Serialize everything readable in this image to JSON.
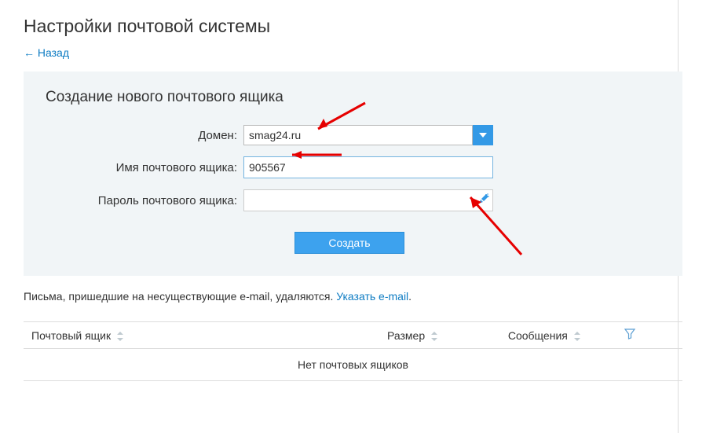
{
  "page_title": "Настройки почтовой системы",
  "back_link": "← Назад",
  "panel": {
    "title": "Создание нового почтового ящика",
    "domain_label": "Домен:",
    "domain_value": "smag24.ru",
    "mailbox_label": "Имя почтового ящика:",
    "mailbox_value": "905567",
    "password_label": "Пароль почтового ящика:",
    "password_value": "",
    "create_button": "Создать"
  },
  "info": {
    "text": "Письма, пришедшие на несуществующие e-mail, удаляются. ",
    "link": "Указать e-mail",
    "dot": "."
  },
  "table": {
    "col_mailbox": "Почтовый ящик",
    "col_size": "Размер",
    "col_messages": "Сообщения",
    "empty": "Нет почтовых ящиков"
  }
}
